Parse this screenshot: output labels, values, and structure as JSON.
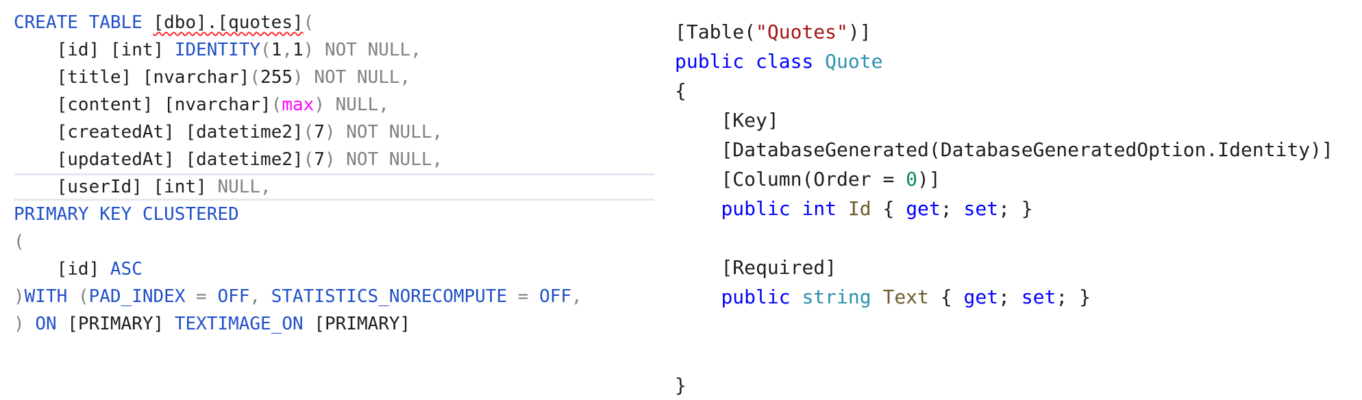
{
  "sql_editor": {
    "lines": [
      {
        "indent": "",
        "tokens": [
          {
            "t": "CREATE TABLE ",
            "c": "sqlkw"
          },
          {
            "t": "[dbo].[quotes]",
            "c": "txt squiggle"
          },
          {
            "t": "(",
            "c": "gray"
          }
        ]
      },
      {
        "indent": "    ",
        "tokens": [
          {
            "t": "[id] [int] ",
            "c": "txt"
          },
          {
            "t": "IDENTITY",
            "c": "sqlkw"
          },
          {
            "t": "(",
            "c": "gray"
          },
          {
            "t": "1",
            "c": "txt"
          },
          {
            "t": ",",
            "c": "gray"
          },
          {
            "t": "1",
            "c": "txt"
          },
          {
            "t": ") NOT NULL,",
            "c": "gray"
          }
        ]
      },
      {
        "indent": "    ",
        "tokens": [
          {
            "t": "[title] [nvarchar]",
            "c": "txt"
          },
          {
            "t": "(",
            "c": "gray"
          },
          {
            "t": "255",
            "c": "txt"
          },
          {
            "t": ") NOT NULL,",
            "c": "gray"
          }
        ]
      },
      {
        "indent": "    ",
        "tokens": [
          {
            "t": "[content] [nvarchar]",
            "c": "txt"
          },
          {
            "t": "(",
            "c": "gray"
          },
          {
            "t": "max",
            "c": "pink"
          },
          {
            "t": ") NULL,",
            "c": "gray"
          }
        ]
      },
      {
        "indent": "    ",
        "tokens": [
          {
            "t": "[createdAt] [datetime2]",
            "c": "txt"
          },
          {
            "t": "(",
            "c": "gray"
          },
          {
            "t": "7",
            "c": "txt"
          },
          {
            "t": ") NOT NULL,",
            "c": "gray"
          }
        ]
      },
      {
        "indent": "    ",
        "tokens": [
          {
            "t": "[updatedAt] [datetime2]",
            "c": "txt"
          },
          {
            "t": "(",
            "c": "gray"
          },
          {
            "t": "7",
            "c": "txt"
          },
          {
            "t": ") NOT NULL,",
            "c": "gray"
          }
        ]
      },
      {
        "indent": "    ",
        "selected": true,
        "tokens": [
          {
            "t": "[userId] [int] ",
            "c": "txt"
          },
          {
            "t": "NULL,",
            "c": "gray"
          }
        ]
      },
      {
        "indent": "",
        "tokens": [
          {
            "t": "PRIMARY KEY CLUSTERED",
            "c": "sqlkw"
          }
        ]
      },
      {
        "indent": "",
        "tokens": [
          {
            "t": "(",
            "c": "gray"
          }
        ]
      },
      {
        "indent": "    ",
        "tokens": [
          {
            "t": "[id] ",
            "c": "txt"
          },
          {
            "t": "ASC",
            "c": "sqlkw"
          }
        ]
      },
      {
        "indent": "",
        "tokens": [
          {
            "t": ")",
            "c": "gray"
          },
          {
            "t": "WITH ",
            "c": "sqlkw"
          },
          {
            "t": "(",
            "c": "gray"
          },
          {
            "t": "PAD_INDEX ",
            "c": "sqlkw"
          },
          {
            "t": "= ",
            "c": "gray"
          },
          {
            "t": "OFF",
            "c": "sqlkw"
          },
          {
            "t": ", ",
            "c": "gray"
          },
          {
            "t": "STATISTICS_NORECOMPUTE ",
            "c": "sqlkw"
          },
          {
            "t": "= ",
            "c": "gray"
          },
          {
            "t": "OFF",
            "c": "sqlkw"
          },
          {
            "t": ",",
            "c": "gray"
          }
        ]
      },
      {
        "indent": "",
        "tokens": [
          {
            "t": ") ",
            "c": "gray"
          },
          {
            "t": "ON ",
            "c": "sqlkw"
          },
          {
            "t": "[PRIMARY] ",
            "c": "txt"
          },
          {
            "t": "TEXTIMAGE_ON ",
            "c": "sqlkw"
          },
          {
            "t": "[PRIMARY]",
            "c": "txt"
          }
        ]
      }
    ]
  },
  "csharp_editor": {
    "lines": [
      {
        "indent": "",
        "tokens": [
          {
            "t": "[Table(",
            "c": "txt"
          },
          {
            "t": "\"Quotes\"",
            "c": "str"
          },
          {
            "t": ")]",
            "c": "txt"
          }
        ]
      },
      {
        "indent": "",
        "tokens": [
          {
            "t": "public class ",
            "c": "kw"
          },
          {
            "t": "Quote",
            "c": "type"
          }
        ]
      },
      {
        "indent": "",
        "tokens": [
          {
            "t": "{",
            "c": "txt"
          }
        ]
      },
      {
        "indent": "    ",
        "tokens": [
          {
            "t": "[Key]",
            "c": "txt"
          }
        ]
      },
      {
        "indent": "    ",
        "tokens": [
          {
            "t": "[DatabaseGenerated(DatabaseGeneratedOption.Identity)]",
            "c": "txt"
          }
        ]
      },
      {
        "indent": "    ",
        "tokens": [
          {
            "t": "[Column(Order = ",
            "c": "txt"
          },
          {
            "t": "0",
            "c": "num"
          },
          {
            "t": ")]",
            "c": "txt"
          }
        ]
      },
      {
        "indent": "    ",
        "tokens": [
          {
            "t": "public ",
            "c": "kw"
          },
          {
            "t": "int ",
            "c": "kw"
          },
          {
            "t": "Id",
            "c": "ident"
          },
          {
            "t": " { ",
            "c": "txt"
          },
          {
            "t": "get",
            "c": "kw"
          },
          {
            "t": "; ",
            "c": "txt"
          },
          {
            "t": "set",
            "c": "kw"
          },
          {
            "t": "; }",
            "c": "txt"
          }
        ]
      },
      {
        "indent": "",
        "tokens": []
      },
      {
        "indent": "    ",
        "tokens": [
          {
            "t": "[Required]",
            "c": "txt"
          }
        ]
      },
      {
        "indent": "    ",
        "tokens": [
          {
            "t": "public ",
            "c": "kw"
          },
          {
            "t": "string ",
            "c": "type"
          },
          {
            "t": "Text",
            "c": "ident"
          },
          {
            "t": " { ",
            "c": "txt"
          },
          {
            "t": "get",
            "c": "kw"
          },
          {
            "t": "; ",
            "c": "txt"
          },
          {
            "t": "set",
            "c": "kw"
          },
          {
            "t": "; }",
            "c": "txt"
          }
        ]
      },
      {
        "indent": "",
        "tokens": []
      },
      {
        "indent": "",
        "tokens": []
      },
      {
        "indent": "",
        "tokens": [
          {
            "t": "}",
            "c": "txt"
          }
        ]
      }
    ]
  }
}
